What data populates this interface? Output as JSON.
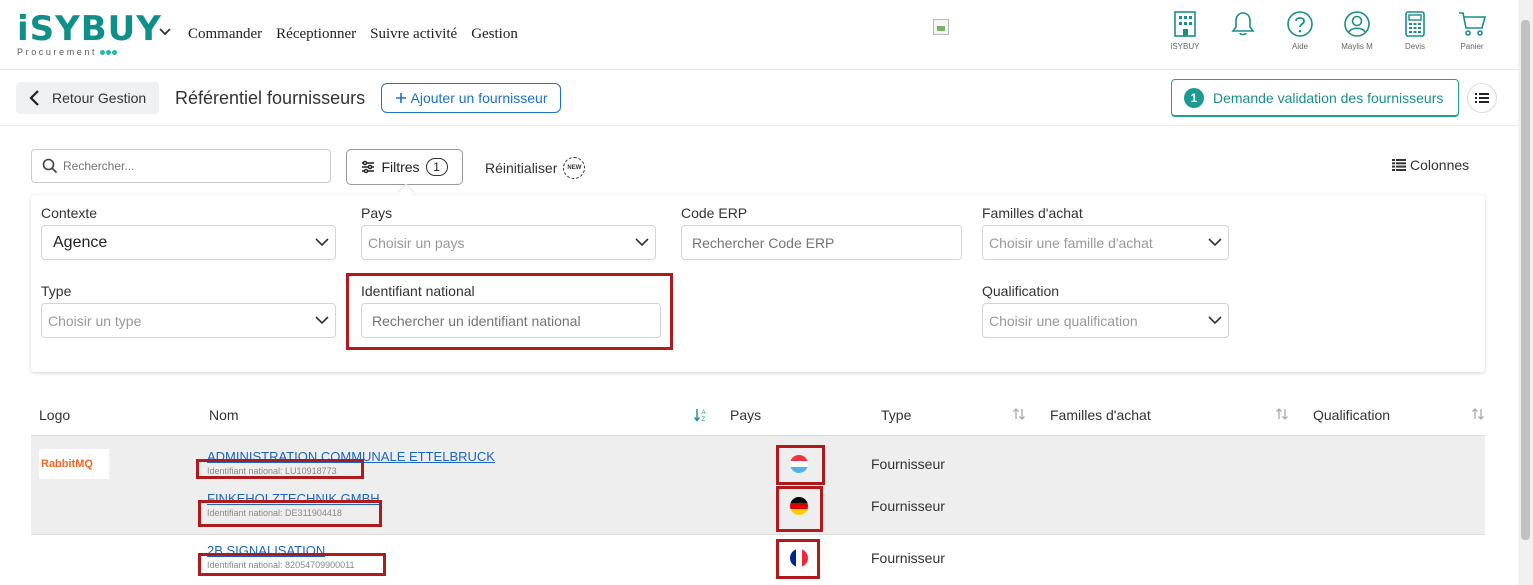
{
  "header": {
    "logo_main": "iSYBUY",
    "logo_sub": "Procurement",
    "nav": [
      "Commander",
      "Réceptionner",
      "Suivre activité",
      "Gestion"
    ],
    "icons": [
      {
        "icon": "building-icon",
        "label": "iSYBUY"
      },
      {
        "icon": "bell-icon",
        "label": ""
      },
      {
        "icon": "help-icon",
        "label": "Aide"
      },
      {
        "icon": "user-icon",
        "label": "Maylis M"
      },
      {
        "icon": "calculator-icon",
        "label": "Devis"
      },
      {
        "icon": "cart-icon",
        "label": "Panier"
      }
    ]
  },
  "subheader": {
    "back_label": "Retour Gestion",
    "title": "Référentiel fournisseurs",
    "add_label": "Ajouter un fournisseur",
    "validation_count": "1",
    "validation_label": "Demande validation des fournisseurs"
  },
  "toolbar": {
    "search_placeholder": "Rechercher...",
    "filters_label": "Filtres",
    "filters_count": "1",
    "reset_label": "Réinitialiser",
    "new_badge": "NEW",
    "columns_label": "Colonnes"
  },
  "filters": {
    "contexte": {
      "label": "Contexte",
      "value": "Agence"
    },
    "pays": {
      "label": "Pays",
      "placeholder": "Choisir un pays"
    },
    "code_erp": {
      "label": "Code ERP",
      "placeholder": "Rechercher Code ERP"
    },
    "familles": {
      "label": "Familles d'achat",
      "placeholder": "Choisir une famille d'achat"
    },
    "type": {
      "label": "Type",
      "placeholder": "Choisir un type"
    },
    "identifiant": {
      "label": "Identifiant national",
      "placeholder": "Rechercher un identifiant national"
    },
    "qualification": {
      "label": "Qualification",
      "placeholder": "Choisir une qualification"
    }
  },
  "table": {
    "columns": [
      "Logo",
      "Nom",
      "Pays",
      "Type",
      "Familles d'achat",
      "Qualification"
    ],
    "rows": [
      {
        "logo": {
          "part1": "RabbitMQ",
          "part2": ""
        },
        "name": "ADMINISTRATION COMMUNALE ETTELBRUCK",
        "national_id": "Identifiant national: LU10918773",
        "country": "LU",
        "type": "Fournisseur"
      },
      {
        "name": "FINKEHOLZTECHNIK GMBH",
        "national_id": "Identifiant national: DE311904418",
        "country": "DE",
        "type": "Fournisseur"
      },
      {
        "name": "2B SIGNALISATION",
        "national_id": "Identifiant national: 82054709900011",
        "country": "FR",
        "type": "Fournisseur"
      }
    ]
  },
  "colors": {
    "brand_teal": "#0f8f8a",
    "link_blue": "#1a66c2",
    "highlight_red": "#b01a1a"
  }
}
